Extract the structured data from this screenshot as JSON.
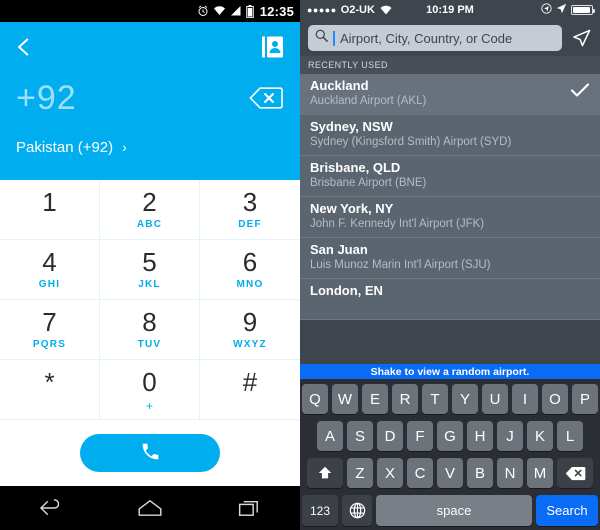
{
  "android": {
    "status": {
      "icons": [
        "alarm-icon",
        "wifi-icon",
        "signal-icon",
        "battery-icon"
      ],
      "clock": "12:35"
    },
    "header": {
      "back_icon": "back-chevron-icon",
      "contacts_icon": "contacts-book-icon",
      "number": "+92",
      "delete_icon": "backspace-icon",
      "country_label": "Pakistan (+92)",
      "country_arrow": "›",
      "accent_color": "#00ADEE"
    },
    "dialpad": [
      {
        "digit": "1",
        "sub": ""
      },
      {
        "digit": "2",
        "sub": "ABC"
      },
      {
        "digit": "3",
        "sub": "DEF"
      },
      {
        "digit": "4",
        "sub": "GHI"
      },
      {
        "digit": "5",
        "sub": "JKL"
      },
      {
        "digit": "6",
        "sub": "MNO"
      },
      {
        "digit": "7",
        "sub": "PQRS"
      },
      {
        "digit": "8",
        "sub": "TUV"
      },
      {
        "digit": "9",
        "sub": "WXYZ"
      },
      {
        "digit": "*",
        "sub": ""
      },
      {
        "digit": "0",
        "sub": "+"
      },
      {
        "digit": "#",
        "sub": ""
      }
    ],
    "call_button": {
      "icon": "phone-handset-icon"
    },
    "navbar": [
      "back-icon",
      "home-icon",
      "recents-icon"
    ]
  },
  "ios": {
    "status": {
      "dots": "●●●●●",
      "carrier": "O2-UK",
      "wifi_icon": "wifi-icon",
      "time": "10:19 PM",
      "right_icons": [
        "location-services-icon",
        "location-arrow-icon",
        "battery-icon"
      ]
    },
    "search": {
      "icon": "search-icon",
      "placeholder": "Airport, City, Country, or Code",
      "value": "",
      "locate_icon": "location-arrow-icon"
    },
    "section_header": "RECENTLY USED",
    "rows": [
      {
        "title": "Auckland",
        "sub": "Auckland Airport (AKL)",
        "selected": true,
        "check": "✓"
      },
      {
        "title": "Sydney, NSW",
        "sub": "Sydney (Kingsford Smith) Airport (SYD)",
        "selected": false,
        "check": ""
      },
      {
        "title": "Brisbane, QLD",
        "sub": "Brisbane Airport (BNE)",
        "selected": false,
        "check": ""
      },
      {
        "title": "New York, NY",
        "sub": "John F. Kennedy Int'l Airport (JFK)",
        "selected": false,
        "check": ""
      },
      {
        "title": "San Juan",
        "sub": "Luis Munoz Marin Int'l Airport (SJU)",
        "selected": false,
        "check": ""
      },
      {
        "title": "London, EN",
        "sub": "",
        "selected": false,
        "check": ""
      }
    ],
    "banner": {
      "text": "Shake to view a random airport.",
      "color": "#0a6cf5"
    },
    "keyboard": {
      "row1": [
        "Q",
        "W",
        "E",
        "R",
        "T",
        "Y",
        "U",
        "I",
        "O",
        "P"
      ],
      "row2": [
        "A",
        "S",
        "D",
        "F",
        "G",
        "H",
        "J",
        "K",
        "L"
      ],
      "row3": [
        "Z",
        "X",
        "C",
        "V",
        "B",
        "N",
        "M"
      ],
      "shift_icon": "shift-arrow-icon",
      "backspace_icon": "backspace-icon",
      "numeric_label": "123",
      "globe_icon": "globe-icon",
      "space_label": "space",
      "search_label": "Search"
    }
  }
}
